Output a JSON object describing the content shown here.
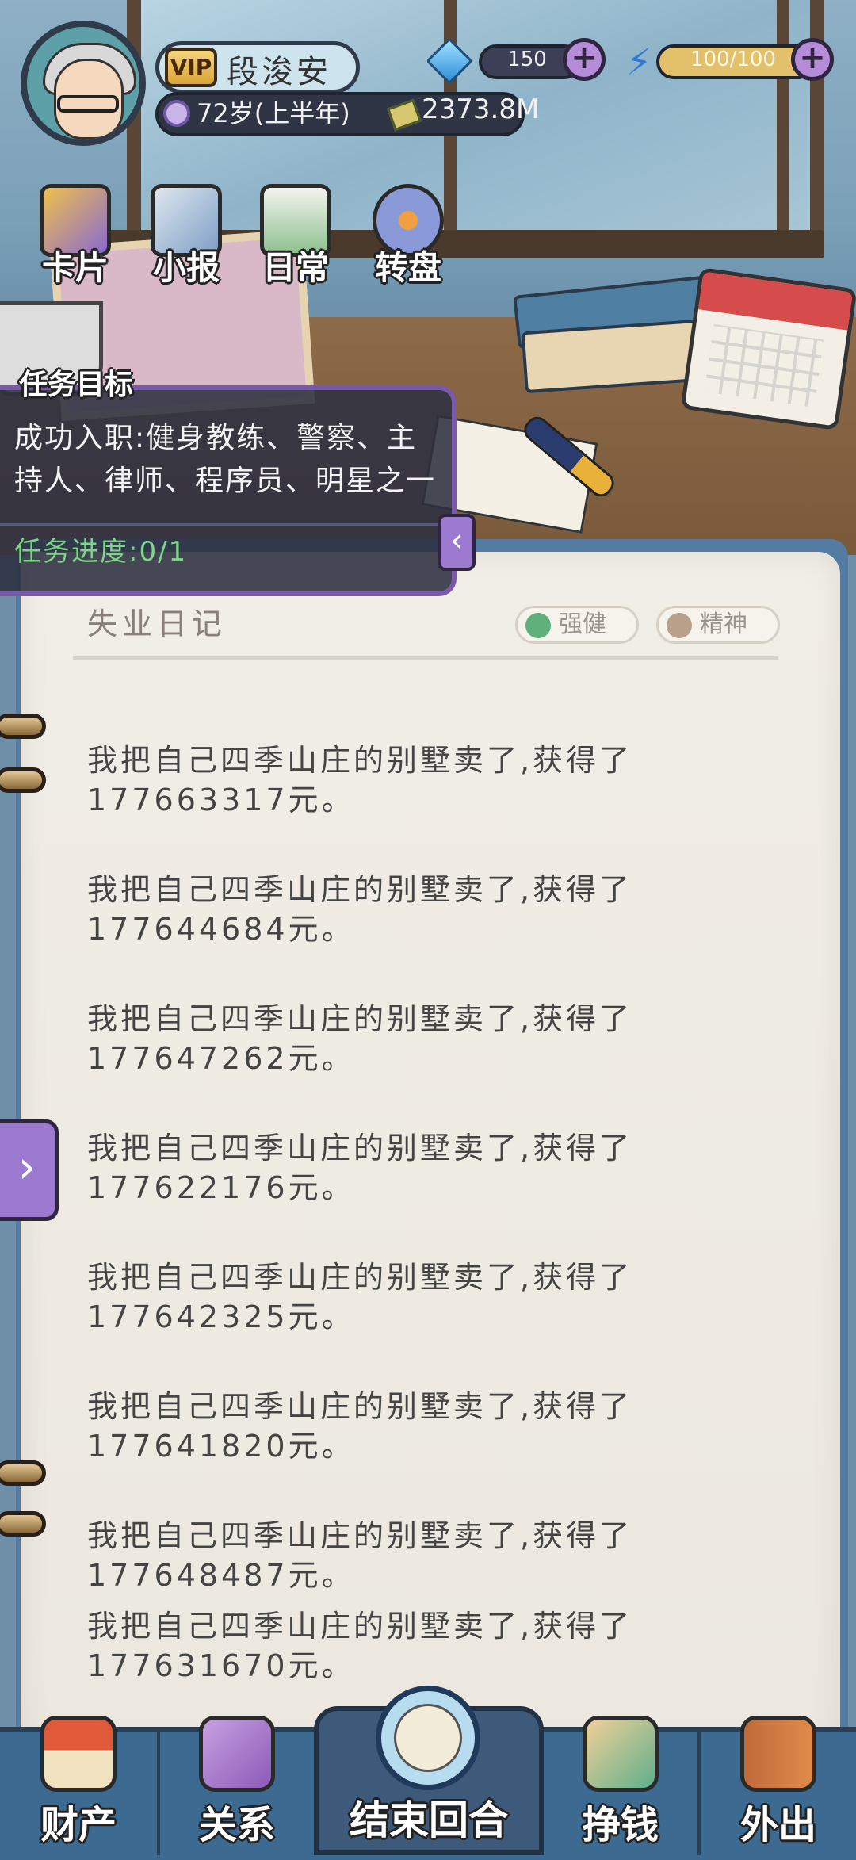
{
  "player": {
    "vip_label": "VIP",
    "name": "段浚安",
    "age": "72岁(上半年)",
    "money": "2373.8M"
  },
  "resources": {
    "gems": "150",
    "energy": "100/100",
    "plus": "+"
  },
  "quick_actions": [
    {
      "label": "卡片",
      "icon": "cards-icon"
    },
    {
      "label": "小报",
      "icon": "newspaper-icon"
    },
    {
      "label": "日常",
      "icon": "clipboard-icon"
    },
    {
      "label": "转盘",
      "icon": "wheel-icon"
    }
  ],
  "task": {
    "title": "任务目标",
    "description": "成功入职:健身教练、警察、主持人、律师、程序员、明星之一",
    "progress": "任务进度:0/1",
    "collapse": "‹"
  },
  "diary": {
    "title": "失业日记",
    "tags": [
      {
        "label": "强健",
        "color": "#5fb07a"
      },
      {
        "label": "精神",
        "color": "#b8a08a"
      }
    ],
    "entries": [
      "我把自己四季山庄的别墅卖了,获得了177663317元。",
      "我把自己四季山庄的别墅卖了,获得了177644684元。",
      "我把自己四季山庄的别墅卖了,获得了177647262元。",
      "我把自己四季山庄的别墅卖了,获得了177622176元。",
      "我把自己四季山庄的别墅卖了,获得了177642325元。",
      "我把自己四季山庄的别墅卖了,获得了177641820元。",
      "我把自己四季山庄的别墅卖了,获得了177648487元。",
      "我把自己四季山庄的别墅卖了,获得了177631670元。"
    ],
    "side_tab": "›"
  },
  "bottom_nav": {
    "property": "财产",
    "relations": "关系",
    "end_turn": "结束回合",
    "earn": "挣钱",
    "go_out": "外出"
  }
}
